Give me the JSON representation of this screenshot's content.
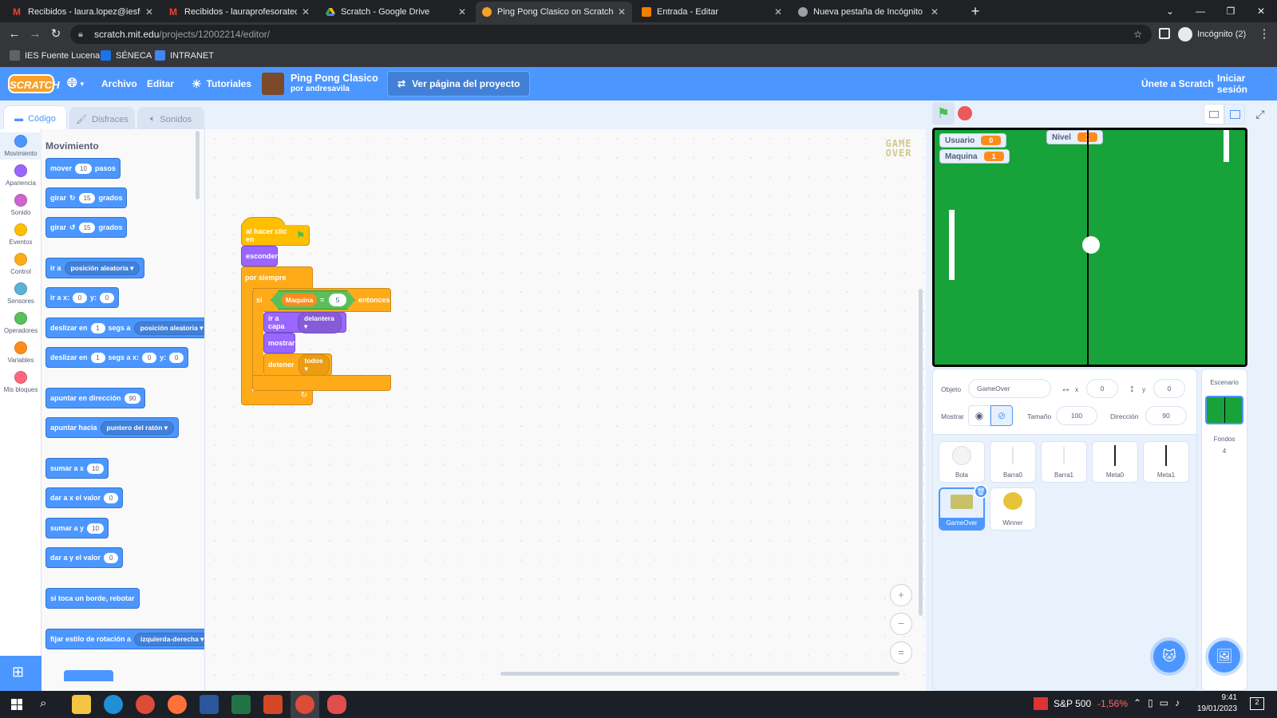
{
  "browser": {
    "tabs": [
      {
        "title": "Recibidos - laura.lopez@iesfuent",
        "icon": "gmail-icon"
      },
      {
        "title": "Recibidos - lauraprofesoratecnol",
        "icon": "gmail-icon"
      },
      {
        "title": "Scratch - Google Drive",
        "icon": "drive-icon"
      },
      {
        "title": "Ping Pong Clasico on Scratch",
        "icon": "scratch-icon"
      },
      {
        "title": "Entrada - Editar",
        "icon": "blogger-icon"
      },
      {
        "title": "Nueva pestaña de Incógnito",
        "icon": "incognito-icon"
      }
    ],
    "url_host": "scratch.mit.edu",
    "url_path": "/projects/12002214/editor/",
    "profile": "Incógnito (2)",
    "bookmarks": [
      "IES Fuente Lucena",
      "SÉNECA",
      "INTRANET"
    ]
  },
  "scratch_menu": {
    "logo": "SCRATCH",
    "archivo": "Archivo",
    "editar": "Editar",
    "tutoriales": "Tutoriales",
    "project_title": "Ping Pong Clasico",
    "author": "por andresavila",
    "view_page": "Ver página del proyecto",
    "join": "Únete a Scratch",
    "signin": "Iniciar sesión"
  },
  "editor_tabs": {
    "code": "Código",
    "costumes": "Disfraces",
    "sounds": "Sonidos"
  },
  "categories": [
    {
      "label": "Movimiento",
      "color": "#4c97ff"
    },
    {
      "label": "Apariencia",
      "color": "#9966ff"
    },
    {
      "label": "Sonido",
      "color": "#cf63cf"
    },
    {
      "label": "Eventos",
      "color": "#ffbf00"
    },
    {
      "label": "Control",
      "color": "#ffab19"
    },
    {
      "label": "Sensores",
      "color": "#5cb1d6"
    },
    {
      "label": "Operadores",
      "color": "#59c059"
    },
    {
      "label": "Variables",
      "color": "#ff8c1a"
    },
    {
      "label": "Mis bloques",
      "color": "#ff6680"
    }
  ],
  "palette": {
    "title": "Movimiento",
    "b1": {
      "a": "mover",
      "n": "10",
      "b": "pasos"
    },
    "b2": {
      "a": "girar",
      "n": "15",
      "b": "grados"
    },
    "b3": {
      "a": "girar",
      "n": "15",
      "b": "grados"
    },
    "b4": {
      "a": "ir a",
      "dd": "posición aleatoria"
    },
    "b5": {
      "a": "ir a x:",
      "n": "0",
      "b": "y:",
      "n2": "0"
    },
    "b6": {
      "a": "deslizar en",
      "n": "1",
      "b": "segs a",
      "dd": "posición aleatoria"
    },
    "b7": {
      "a": "deslizar en",
      "n": "1",
      "b": "segs a x:",
      "n2": "0",
      "c": "y:",
      "n3": "0"
    },
    "b8": {
      "a": "apuntar en dirección",
      "n": "90"
    },
    "b9": {
      "a": "apuntar hacia",
      "dd": "puntero del ratón"
    },
    "b10": {
      "a": "sumar a x",
      "n": "10"
    },
    "b11": {
      "a": "dar a x el valor",
      "n": "0"
    },
    "b12": {
      "a": "sumar a y",
      "n": "10"
    },
    "b13": {
      "a": "dar a y el valor",
      "n": "0"
    },
    "b14": {
      "a": "si toca un borde, rebotar"
    },
    "b15": {
      "a": "fijar estilo de rotación a",
      "dd": "izquierda-derecha"
    }
  },
  "script": {
    "hat": "al hacer clic en",
    "hide": "esconder",
    "forever": "por siempre",
    "if": "si",
    "var": "Maquina",
    "op": "=",
    "val": "5",
    "then": "entonces",
    "layer": "ir a capa",
    "layer_dd": "delantera",
    "show": "mostrar",
    "stop": "detener",
    "stop_dd": "todos"
  },
  "code_area": {
    "sprite_watermark": "GAME OVER",
    "zoom_in": "+",
    "zoom_out": "−",
    "zoom_reset": "="
  },
  "stage": {
    "monitors": [
      {
        "label": "Usuario",
        "value": "0"
      },
      {
        "label": "Maquina",
        "value": "1"
      },
      {
        "label": "Nivel",
        "value": "1"
      }
    ]
  },
  "sprite_info": {
    "objeto_label": "Objeto",
    "name": "GameOver",
    "x_label": "x",
    "x": "0",
    "y_label": "y",
    "y": "0",
    "mostrar_label": "Mostrar",
    "size_label": "Tamaño",
    "size": "100",
    "dir_label": "Dirección",
    "dir": "90"
  },
  "sprites": [
    "Bola",
    "Barra0",
    "Barra1",
    "Meta0",
    "Meta1",
    "GameOver",
    "Winner"
  ],
  "stage_pane": {
    "title": "Escenario",
    "backdrops_label": "Fondos",
    "backdrops": "4"
  },
  "taskbar": {
    "stock": "S&P 500",
    "change": "-1,56%",
    "time": "9:41",
    "date": "19/01/2023",
    "notif": "2"
  }
}
